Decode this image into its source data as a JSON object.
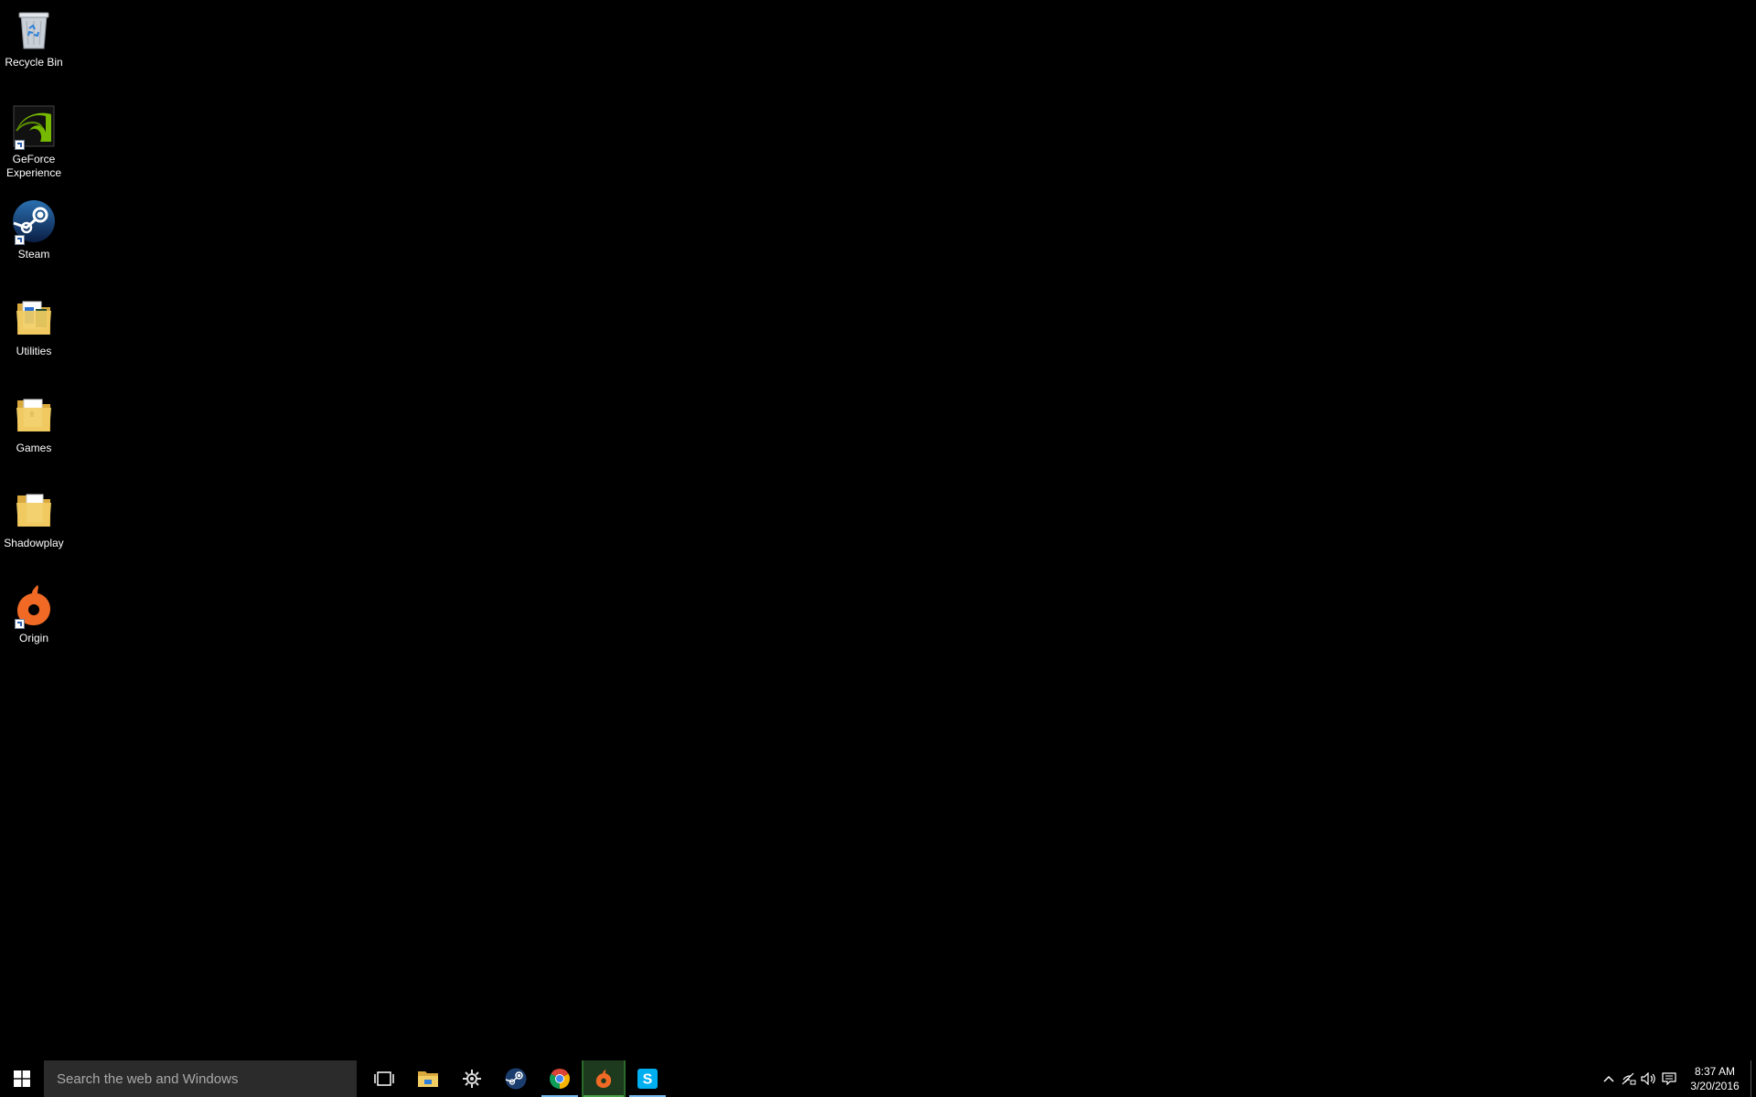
{
  "desktop": {
    "icons": [
      {
        "label": "Recycle Bin",
        "icon": "recycle-bin-icon",
        "shortcut": false
      },
      {
        "label": "GeForce Experience",
        "icon": "geforce-experience-icon",
        "shortcut": true
      },
      {
        "label": "Steam",
        "icon": "steam-icon",
        "shortcut": true
      },
      {
        "label": "Utilities",
        "icon": "folder-icon",
        "shortcut": false
      },
      {
        "label": "Games",
        "icon": "folder-icon",
        "shortcut": false
      },
      {
        "label": "Shadowplay",
        "icon": "folder-icon",
        "shortcut": false
      },
      {
        "label": "Origin",
        "icon": "origin-icon",
        "shortcut": true
      }
    ]
  },
  "taskbar": {
    "search": {
      "placeholder": "Search the web and Windows",
      "value": ""
    },
    "pinned": [
      {
        "name": "task-view",
        "icon": "task-view-icon",
        "running": false
      },
      {
        "name": "file-explorer",
        "icon": "folder-icon",
        "running": false
      },
      {
        "name": "origin-settings",
        "icon": "settings-gear-icon",
        "running": false
      },
      {
        "name": "steam",
        "icon": "steam-icon",
        "running": false
      },
      {
        "name": "chrome",
        "icon": "chrome-icon",
        "running": true
      },
      {
        "name": "origin",
        "icon": "origin-icon",
        "running": true,
        "active": true
      },
      {
        "name": "skype",
        "icon": "skype-icon",
        "running": true
      }
    ],
    "tray": {
      "icons": [
        "chevron-up-icon",
        "network-icon",
        "volume-icon",
        "action-center-icon"
      ],
      "time": "8:37 AM",
      "date": "3/20/2016"
    }
  },
  "colors": {
    "background": "#000000",
    "taskbar": "#000000",
    "search_box": "#2b2b2b",
    "running_indicator": "#76b9ed",
    "active_indicator": "#4ca34c",
    "origin_orange": "#f06a25",
    "skype_blue": "#00aff0",
    "nvidia_green": "#76b900"
  }
}
